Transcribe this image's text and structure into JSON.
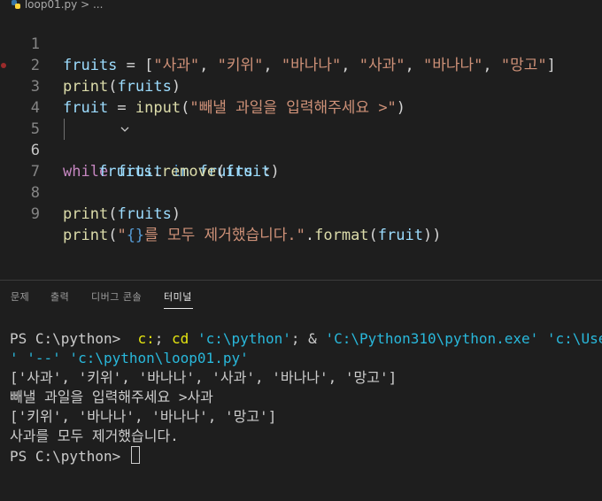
{
  "breadcrumb": {
    "file": "loop01.py",
    "separator": ">",
    "ellipsis": "..."
  },
  "editor": {
    "line_numbers": [
      "1",
      "2",
      "3",
      "4",
      "5",
      "6",
      "7",
      "8",
      "9"
    ],
    "line1": {
      "t1": "fruits",
      "t2": " = [",
      "t3": "\"사과\"",
      "t4": ", ",
      "t5": "\"키위\"",
      "t6": ", ",
      "t7": "\"바나나\"",
      "t8": ", ",
      "t9": "\"사과\"",
      "t10": ", ",
      "t11": "\"바나나\"",
      "t12": ", ",
      "t13": "\"망고\"",
      "t14": "]"
    },
    "line2": {
      "t1": "print",
      "t2": "(",
      "t3": "fruits",
      "t4": ")"
    },
    "line3": {
      "t1": "fruit",
      "t2": " = ",
      "t3": "input",
      "t4": "(",
      "t5": "\"빼낼 과일을 입력해주세요 >\"",
      "t6": ")"
    },
    "line5": {
      "t1": "while",
      "t2": " ",
      "t3": "fruit",
      "t4": " ",
      "t5": "in",
      "t6": " ",
      "t7": "fruits",
      "t8": " :"
    },
    "line6": {
      "t1": "fruits",
      "t2": ".",
      "t3": "remove",
      "t4": "(",
      "t5": "fruit",
      "t6": ")"
    },
    "line8": {
      "t1": "print",
      "t2": "(",
      "t3": "fruits",
      "t4": ")"
    },
    "line9": {
      "t1": "print",
      "t2": "(",
      "t3": "\"",
      "t4": "{}",
      "t5": "를 모두 제거했습니다.\"",
      "t6": ".",
      "t7": "format",
      "t8": "(",
      "t9": "fruit",
      "t10": "))"
    }
  },
  "panel": {
    "tabs": [
      "문제",
      "출력",
      "디버그 콘솔",
      "터미널"
    ],
    "active_tab": "터미널"
  },
  "terminal": {
    "cmd1": {
      "prompt": "PS C:\\python> ",
      "t1": " c:",
      "t2": "; ",
      "t3": "cd",
      "t4": " ",
      "t5": "'c:\\python'",
      "t6": "; & ",
      "t7": "'C:\\Python310\\python.exe'",
      "t8": " ",
      "t9": "'c:\\Users\\dl"
    },
    "cmd1_wrap": {
      "t1": "' '--' 'c:\\python\\loop01.py'"
    },
    "out1": "['사과', '키위', '바나나', '사과', '바나나', '망고']",
    "out2": "빼낼 과일을 입력해주세요 >사과",
    "out3": "['키위', '바나나', '바나나', '망고']",
    "out4": "사과를 모두 제거했습니다.",
    "prompt2": "PS C:\\python> "
  },
  "colors": {
    "background": "#1e1e1e",
    "keyword_control": "#c586c0",
    "keyword": "#569cd6",
    "variable": "#9cdcfe",
    "function": "#dcdcaa",
    "string": "#ce9178",
    "terminal_yellow": "#e5e510",
    "terminal_cyan": "#29b8db"
  }
}
